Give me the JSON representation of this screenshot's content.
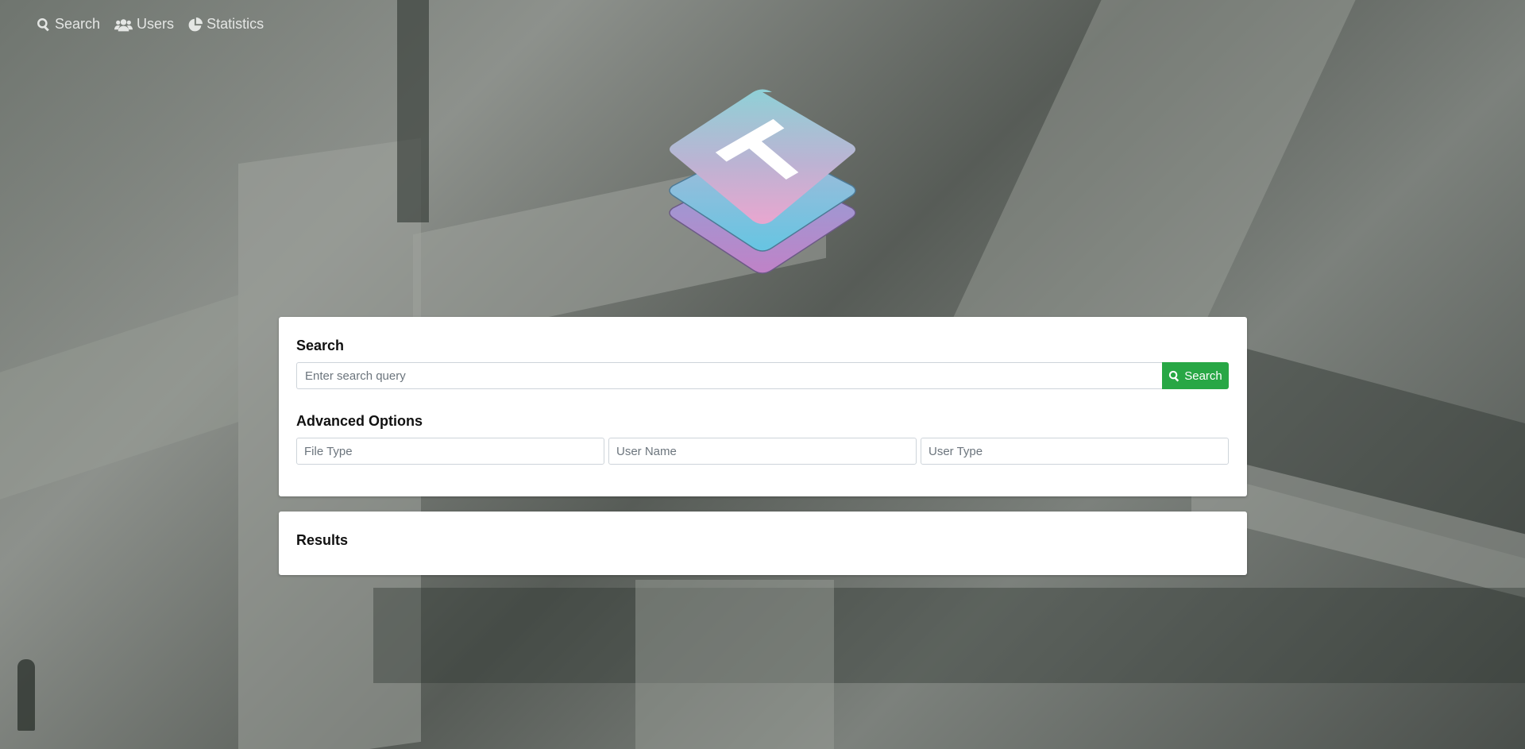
{
  "nav": {
    "items": [
      {
        "label": "Search",
        "icon": "search-icon"
      },
      {
        "label": "Users",
        "icon": "users-icon"
      },
      {
        "label": "Statistics",
        "icon": "pie-chart-icon"
      }
    ]
  },
  "logo": {
    "letter": "T",
    "colors": {
      "top": "#8fcfd6",
      "middle": "#e2a8d2",
      "bottom": "#b483c8",
      "accent": "#6fc2e0"
    }
  },
  "search": {
    "title": "Search",
    "placeholder": "Enter search query",
    "button_label": "Search",
    "button_color": "#28a745"
  },
  "advanced": {
    "title": "Advanced Options",
    "file_type_placeholder": "File Type",
    "user_name_placeholder": "User Name",
    "user_type_placeholder": "User Type"
  },
  "results": {
    "title": "Results"
  }
}
